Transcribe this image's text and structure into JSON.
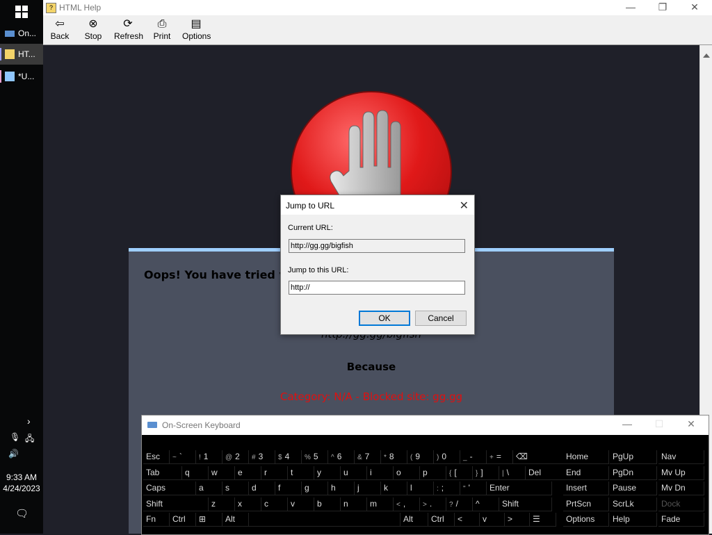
{
  "taskbar": {
    "items": [
      {
        "label": "On..."
      },
      {
        "label": "HT..."
      },
      {
        "label": "*U..."
      }
    ],
    "clock": {
      "time": "9:33 AM",
      "date": "4/24/2023"
    }
  },
  "window": {
    "title": "HTML Help",
    "toolbar": [
      {
        "label": "Back",
        "icon": "back-arrow-icon"
      },
      {
        "label": "Stop",
        "icon": "stop-icon"
      },
      {
        "label": "Refresh",
        "icon": "refresh-icon"
      },
      {
        "label": "Print",
        "icon": "printer-icon"
      },
      {
        "label": "Options",
        "icon": "options-icon"
      }
    ]
  },
  "page": {
    "oops_text": "Oops! You have tried vi                                          eemed inappropriate:",
    "blocked_url": "http://gg.gg/bigfish",
    "because": "Because",
    "category_line": "Category: N/A - Blocked site: gg.gg"
  },
  "dialog": {
    "title": "Jump to URL",
    "current_url_label": "Current URL:",
    "current_url_value": "http://gg.gg/bigfish",
    "jump_label": "Jump to this URL:",
    "jump_value": "http://",
    "ok_label": "OK",
    "cancel_label": "Cancel"
  },
  "osk": {
    "title": "On-Screen Keyboard",
    "rows": [
      [
        {
          "l": "Esc"
        },
        {
          "s": "~",
          "l": "`"
        },
        {
          "s": "!",
          "l": "1"
        },
        {
          "s": "@",
          "l": "2"
        },
        {
          "s": "#",
          "l": "3"
        },
        {
          "s": "$",
          "l": "4"
        },
        {
          "s": "%",
          "l": "5"
        },
        {
          "s": "^",
          "l": "6"
        },
        {
          "s": "&",
          "l": "7"
        },
        {
          "s": "*",
          "l": "8"
        },
        {
          "s": "(",
          "l": "9"
        },
        {
          "s": ")",
          "l": "0"
        },
        {
          "s": "_",
          "l": "-"
        },
        {
          "s": "+",
          "l": "="
        },
        {
          "l": "⌫"
        }
      ],
      [
        {
          "l": "Tab"
        },
        {
          "l": "q"
        },
        {
          "l": "w"
        },
        {
          "l": "e"
        },
        {
          "l": "r"
        },
        {
          "l": "t"
        },
        {
          "l": "y"
        },
        {
          "l": "u"
        },
        {
          "l": "i"
        },
        {
          "l": "o"
        },
        {
          "l": "p"
        },
        {
          "s": "{",
          "l": "["
        },
        {
          "s": "}",
          "l": "]"
        },
        {
          "s": "|",
          "l": "\\"
        },
        {
          "l": "Del"
        }
      ],
      [
        {
          "l": "Caps"
        },
        {
          "l": "a"
        },
        {
          "l": "s"
        },
        {
          "l": "d"
        },
        {
          "l": "f"
        },
        {
          "l": "g"
        },
        {
          "l": "h"
        },
        {
          "l": "j"
        },
        {
          "l": "k"
        },
        {
          "l": "l"
        },
        {
          "s": ":",
          "l": ";"
        },
        {
          "s": "\"",
          "l": "'"
        },
        {
          "l": "Enter"
        }
      ],
      [
        {
          "l": "Shift"
        },
        {
          "l": "z"
        },
        {
          "l": "x"
        },
        {
          "l": "c"
        },
        {
          "l": "v"
        },
        {
          "l": "b"
        },
        {
          "l": "n"
        },
        {
          "l": "m"
        },
        {
          "s": "<",
          "l": ","
        },
        {
          "s": ">",
          "l": "."
        },
        {
          "s": "?",
          "l": "/"
        },
        {
          "l": "^"
        },
        {
          "l": "Shift"
        }
      ],
      [
        {
          "l": "Fn"
        },
        {
          "l": "Ctrl"
        },
        {
          "l": "⊞"
        },
        {
          "l": "Alt"
        },
        {
          "l": ""
        },
        {
          "l": "Alt"
        },
        {
          "l": "Ctrl"
        },
        {
          "l": "<"
        },
        {
          "l": "v"
        },
        {
          "l": ">"
        },
        {
          "l": "☰"
        }
      ]
    ],
    "nav_keys": [
      [
        "Home",
        "PgUp",
        "Nav"
      ],
      [
        "End",
        "PgDn",
        "Mv Up"
      ],
      [
        "Insert",
        "Pause",
        "Mv Dn"
      ],
      [
        "PrtScn",
        "ScrLk",
        "Dock"
      ],
      [
        "Options",
        "Help",
        "Fade"
      ]
    ]
  },
  "colors": {
    "page_bg": "#1f2029",
    "panel_bg": "#4a505f",
    "panel_accent": "#9fcfff",
    "stop_red": "#e01919",
    "category_red": "#e01010"
  }
}
